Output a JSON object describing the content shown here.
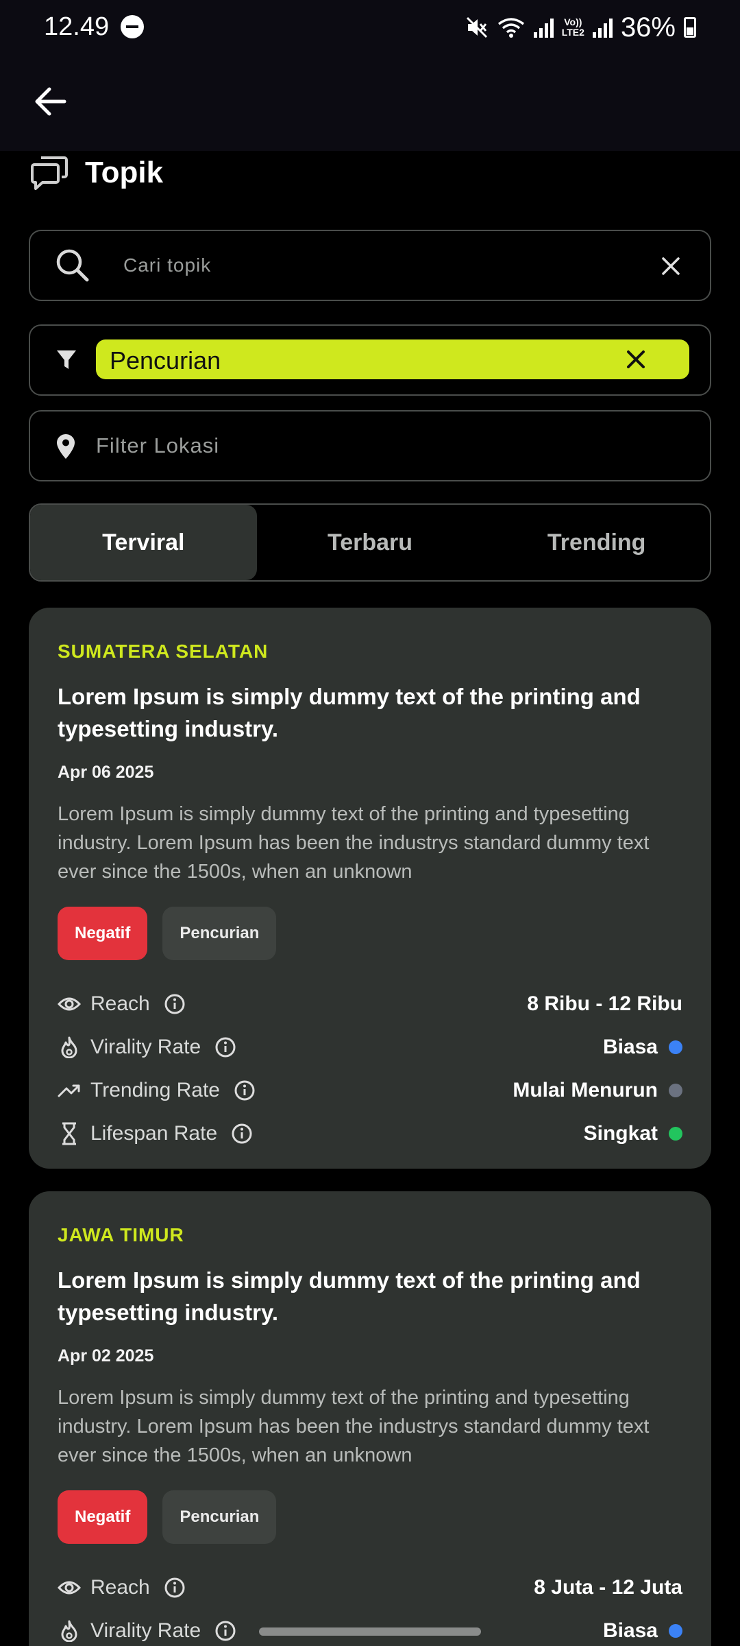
{
  "status": {
    "time": "12.49",
    "battery": "36%",
    "network": "Vo)) LTE2"
  },
  "header": {
    "title": "Topik"
  },
  "search": {
    "placeholder": "Cari topik"
  },
  "filter": {
    "selected": "Pencurian"
  },
  "location": {
    "placeholder": "Filter Lokasi"
  },
  "tabs": [
    {
      "label": "Terviral",
      "active": true
    },
    {
      "label": "Terbaru",
      "active": false
    },
    {
      "label": "Trending",
      "active": false
    }
  ],
  "colors": {
    "accent": "#cfe81e",
    "negative": "#e3333c",
    "blue": "#3b82f6",
    "gray": "#6b7280",
    "green": "#22c55e"
  },
  "cards": [
    {
      "region": "SUMATERA SELATAN",
      "title": "Lorem Ipsum is simply dummy text of the printing and typesetting industry.",
      "date": "Apr 06 2025",
      "description": "Lorem Ipsum is simply dummy text of the printing and typesetting industry. Lorem Ipsum has been the industrys standard dummy text ever since the 1500s, when an unknown",
      "tags": [
        "Negatif",
        "Pencurian"
      ],
      "metrics": [
        {
          "label": "Reach",
          "value": "8 Ribu - 12 Ribu",
          "icon": "eye-icon"
        },
        {
          "label": "Virality Rate",
          "value": "Biasa",
          "icon": "flame-icon",
          "dot": "blue"
        },
        {
          "label": "Trending Rate",
          "value": "Mulai Menurun",
          "icon": "trend-icon",
          "dot": "gray"
        },
        {
          "label": "Lifespan Rate",
          "value": "Singkat",
          "icon": "hourglass-icon",
          "dot": "green"
        }
      ]
    },
    {
      "region": "JAWA TIMUR",
      "title": "Lorem Ipsum is simply dummy text of the printing and typesetting industry.",
      "date": "Apr 02 2025",
      "description": "Lorem Ipsum is simply dummy text of the printing and typesetting industry. Lorem Ipsum has been the industrys standard dummy text ever since the 1500s, when an unknown",
      "tags": [
        "Negatif",
        "Pencurian"
      ],
      "metrics": [
        {
          "label": "Reach",
          "value": "8 Juta - 12 Juta",
          "icon": "eye-icon"
        },
        {
          "label": "Virality Rate",
          "value": "Biasa",
          "icon": "flame-icon",
          "dot": "blue"
        }
      ]
    }
  ]
}
